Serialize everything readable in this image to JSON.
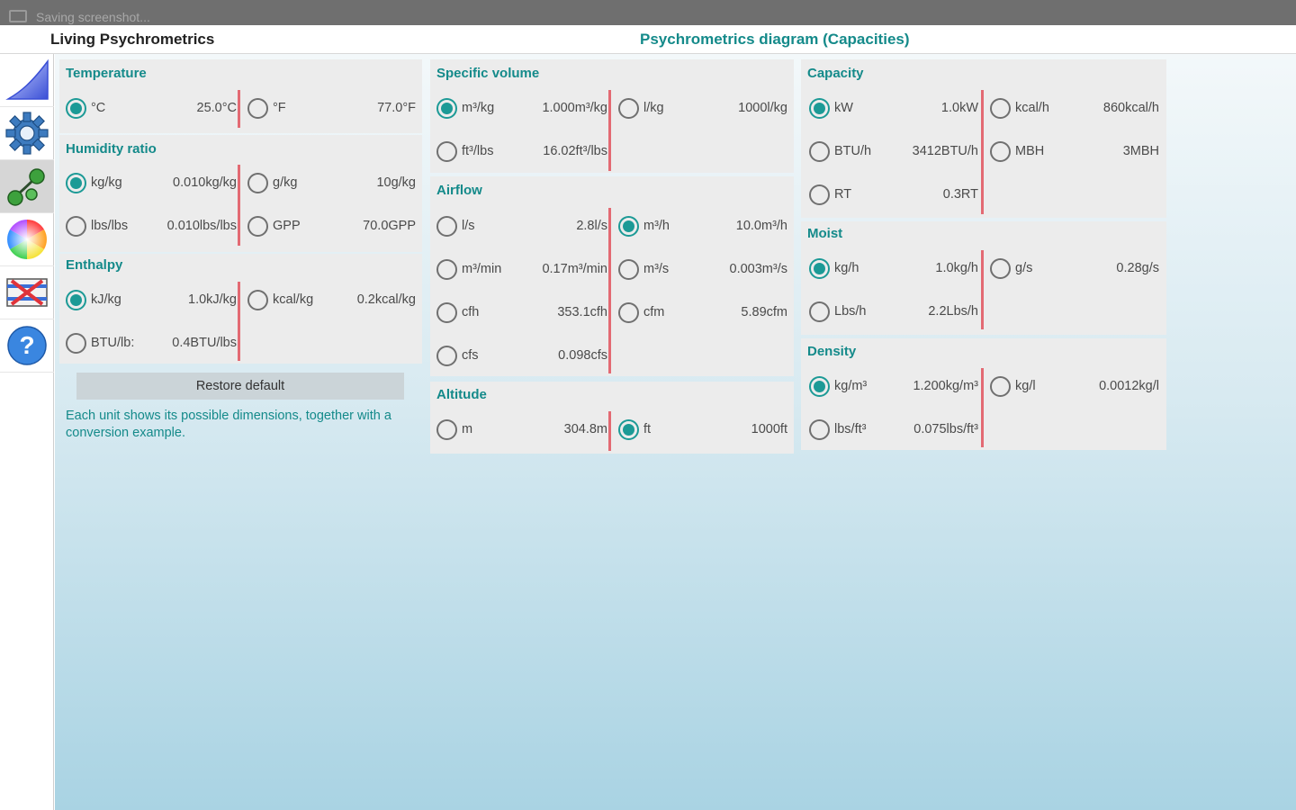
{
  "statusbar": {
    "text": "Saving screenshot..."
  },
  "app": {
    "title": "Living Psychrometrics",
    "diagram_title": "Psychrometrics diagram (Capacities)"
  },
  "sidebar": {
    "items": [
      {
        "icon": "chart-curve-icon"
      },
      {
        "icon": "gear-icon"
      },
      {
        "icon": "units-conversion-icon",
        "active": true
      },
      {
        "icon": "color-wheel-icon"
      },
      {
        "icon": "heat-exchanger-icon"
      },
      {
        "icon": "help-icon"
      }
    ]
  },
  "temperature": {
    "title": "Temperature",
    "options": [
      {
        "unit": "°C",
        "value": "25.0°C",
        "selected": true
      },
      {
        "unit": "°F",
        "value": "77.0°F",
        "selected": false
      }
    ]
  },
  "humidity_ratio": {
    "title": "Humidity ratio",
    "options": [
      {
        "unit": "kg/kg",
        "value": "0.010kg/kg",
        "selected": true
      },
      {
        "unit": "g/kg",
        "value": "10g/kg",
        "selected": false
      },
      {
        "unit": "lbs/lbs",
        "value": "0.010lbs/lbs",
        "selected": false
      },
      {
        "unit": "GPP",
        "value": "70.0GPP",
        "selected": false
      }
    ]
  },
  "enthalpy": {
    "title": "Enthalpy",
    "options": [
      {
        "unit": "kJ/kg",
        "value": "1.0kJ/kg",
        "selected": true
      },
      {
        "unit": "kcal/kg",
        "value": "0.2kcal/kg",
        "selected": false
      },
      {
        "unit": "BTU/lb:",
        "value": "0.4BTU/lbs",
        "selected": false
      }
    ]
  },
  "restore_label": "Restore default",
  "hint": "Each unit shows its possible dimensions, together with a conversion example.",
  "specific_volume": {
    "title": "Specific volume",
    "options": [
      {
        "unit": "m³/kg",
        "value": "1.000m³/kg",
        "selected": true
      },
      {
        "unit": "l/kg",
        "value": "1000l/kg",
        "selected": false
      },
      {
        "unit": "ft³/lbs",
        "value": "16.02ft³/lbs",
        "selected": false
      }
    ]
  },
  "airflow": {
    "title": "Airflow",
    "options": [
      {
        "unit": "l/s",
        "value": "2.8l/s",
        "selected": false
      },
      {
        "unit": "m³/h",
        "value": "10.0m³/h",
        "selected": true
      },
      {
        "unit": "m³/min",
        "value": "0.17m³/min",
        "selected": false
      },
      {
        "unit": "m³/s",
        "value": "0.003m³/s",
        "selected": false
      },
      {
        "unit": "cfh",
        "value": "353.1cfh",
        "selected": false
      },
      {
        "unit": "cfm",
        "value": "5.89cfm",
        "selected": false
      },
      {
        "unit": "cfs",
        "value": "0.098cfs",
        "selected": false
      }
    ]
  },
  "altitude": {
    "title": "Altitude",
    "options": [
      {
        "unit": "m",
        "value": "304.8m",
        "selected": false
      },
      {
        "unit": "ft",
        "value": "1000ft",
        "selected": true
      }
    ]
  },
  "capacity": {
    "title": "Capacity",
    "options": [
      {
        "unit": "kW",
        "value": "1.0kW",
        "selected": true
      },
      {
        "unit": "kcal/h",
        "value": "860kcal/h",
        "selected": false
      },
      {
        "unit": "BTU/h",
        "value": "3412BTU/h",
        "selected": false
      },
      {
        "unit": "MBH",
        "value": "3MBH",
        "selected": false
      },
      {
        "unit": "RT",
        "value": "0.3RT",
        "selected": false
      }
    ]
  },
  "moist": {
    "title": "Moist",
    "options": [
      {
        "unit": "kg/h",
        "value": "1.0kg/h",
        "selected": true
      },
      {
        "unit": "g/s",
        "value": "0.28g/s",
        "selected": false
      },
      {
        "unit": "Lbs/h",
        "value": "2.2Lbs/h",
        "selected": false
      }
    ]
  },
  "density": {
    "title": "Density",
    "options": [
      {
        "unit": "kg/m³",
        "value": "1.200kg/m³",
        "selected": true
      },
      {
        "unit": "kg/l",
        "value": "0.0012kg/l",
        "selected": false
      },
      {
        "unit": "lbs/ft³",
        "value": "0.075lbs/ft³",
        "selected": false
      }
    ]
  },
  "colors": {
    "accent": "#1c9a96",
    "title_text": "#148a8a",
    "divider": "#e36a73"
  }
}
